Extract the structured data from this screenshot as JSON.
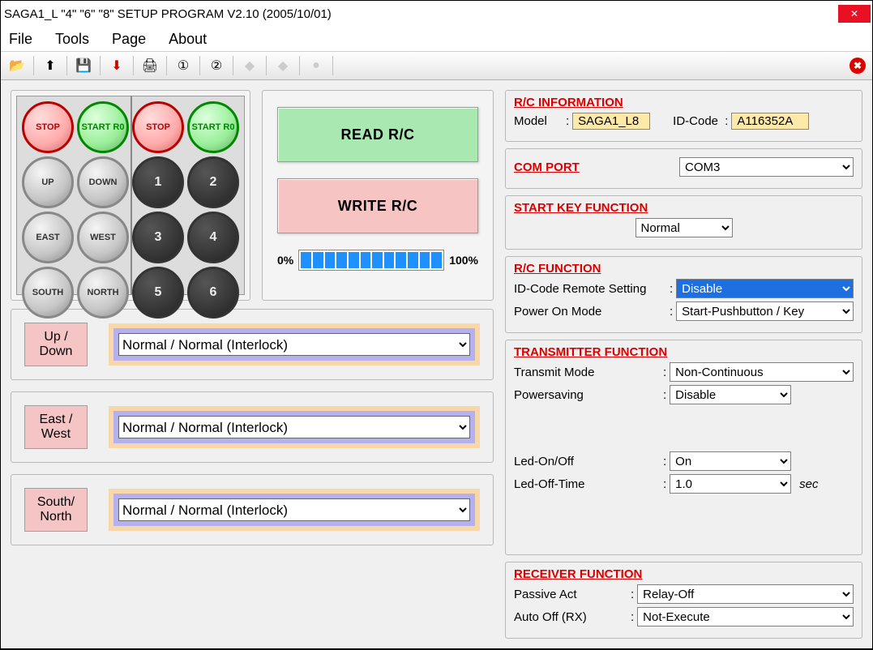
{
  "window": {
    "title": "SAGA1_L \"4\" \"6\" \"8\" SETUP PROGRAM V2.10 (2005/10/01)"
  },
  "menu": {
    "file": "File",
    "tools": "Tools",
    "page": "Page",
    "about": "About"
  },
  "toolbar": {
    "open": "📂",
    "up": "⬆",
    "save": "💾",
    "down": "⬇",
    "print": "🖨",
    "one": "①",
    "two": "②"
  },
  "buttons": {
    "read": "READ  R/C",
    "write": "WRITE R/C"
  },
  "progress": {
    "min": "0%",
    "max": "100%"
  },
  "directions": {
    "updown": {
      "label": "Up  /\nDown",
      "value": "Normal / Normal (Interlock)"
    },
    "eastwest": {
      "label": "East /\nWest",
      "value": "Normal / Normal (Interlock)"
    },
    "southnorth": {
      "label": "South/\nNorth",
      "value": "Normal / Normal (Interlock)"
    }
  },
  "rc_info": {
    "title": "R/C INFORMATION",
    "model_label": "Model",
    "model_value": "SAGA1_L8",
    "id_label": "ID-Code",
    "id_value": "A116352A"
  },
  "com_port": {
    "title": "COM  PORT",
    "value": "COM3"
  },
  "start_key": {
    "title": "START KEY FUNCTION",
    "value": "Normal"
  },
  "rc_func": {
    "title": "R/C  FUNCTION",
    "remote_label": "ID-Code Remote Setting",
    "remote_value": "Disable",
    "power_label": "Power On Mode",
    "power_value": "Start-Pushbutton / Key"
  },
  "tx_func": {
    "title": "TRANSMITTER FUNCTION",
    "mode_label": "Transmit Mode",
    "mode_value": "Non-Continuous",
    "psave_label": "Powersaving",
    "psave_value": "Disable",
    "led_label": "Led-On/Off",
    "led_value": "On",
    "ledtime_label": "Led-Off-Time",
    "ledtime_value": "1.0",
    "sec": "sec"
  },
  "rx_func": {
    "title": "RECEIVER  FUNCTION",
    "passive_label": "Passive Act",
    "passive_value": "Relay-Off",
    "auto_label": "Auto Off (RX)",
    "auto_value": "Not-Execute"
  },
  "keypad": {
    "r1": [
      "STOP",
      "START\nR0",
      "STOP",
      "START\nR0"
    ],
    "r2": [
      "UP",
      "DOWN",
      "1",
      "2"
    ],
    "r3": [
      "EAST",
      "WEST",
      "3",
      "4"
    ],
    "r4": [
      "SOUTH",
      "NORTH",
      "5",
      "6"
    ]
  }
}
